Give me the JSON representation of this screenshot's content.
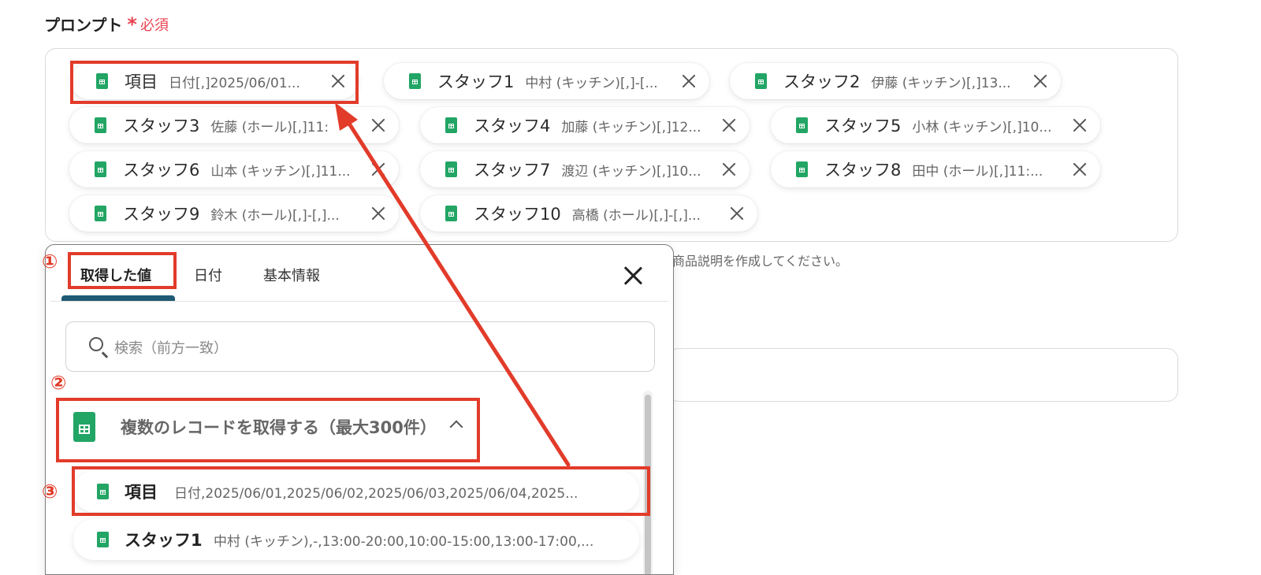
{
  "prompt_label": "プロンプト",
  "required_star": "*",
  "required_text": "必須",
  "chips": [
    {
      "label": "項目",
      "value": "日付[,]2025/06/01..."
    },
    {
      "label": "スタッフ1",
      "value": "中村 (キッチン)[,]-[..."
    },
    {
      "label": "スタッフ2",
      "value": "伊藤 (キッチン)[,]13..."
    },
    {
      "label": "スタッフ3",
      "value": "佐藤 (ホール)[,]11:"
    },
    {
      "label": "スタッフ4",
      "value": "加藤 (キッチン)[,]12..."
    },
    {
      "label": "スタッフ5",
      "value": "小林 (キッチン)[,]10..."
    },
    {
      "label": "スタッフ6",
      "value": "山本 (キッチン)[,]11..."
    },
    {
      "label": "スタッフ7",
      "value": "渡辺 (キッチン)[,]10..."
    },
    {
      "label": "スタッフ8",
      "value": "田中 (ホール)[,]11:..."
    },
    {
      "label": "スタッフ9",
      "value": "鈴木 (ホール)[,]-[,]..."
    },
    {
      "label": "スタッフ10",
      "value": "高橋 (ホール)[,]-[,]..."
    }
  ],
  "helper_text": "商品説明を作成してください。",
  "popup": {
    "tabs": [
      "取得した値",
      "日付",
      "基本情報"
    ],
    "search_placeholder": "検索（前方一致）",
    "group_title": "複数のレコードを取得する（最大300件）",
    "items": [
      {
        "label": "項目",
        "value": "日付,2025/06/01,2025/06/02,2025/06/03,2025/06/04,2025..."
      },
      {
        "label": "スタッフ1",
        "value": "中村 (キッチン),-,13:00-20:00,10:00-15:00,13:00-17:00,..."
      }
    ]
  },
  "annotations": {
    "step1": "①",
    "step2": "②",
    "step3": "③"
  },
  "colors": {
    "accent_red": "#e23b2a",
    "sheet_green": "#22a565",
    "tab_underline": "#1f5a74",
    "required_red": "#e8434f"
  }
}
